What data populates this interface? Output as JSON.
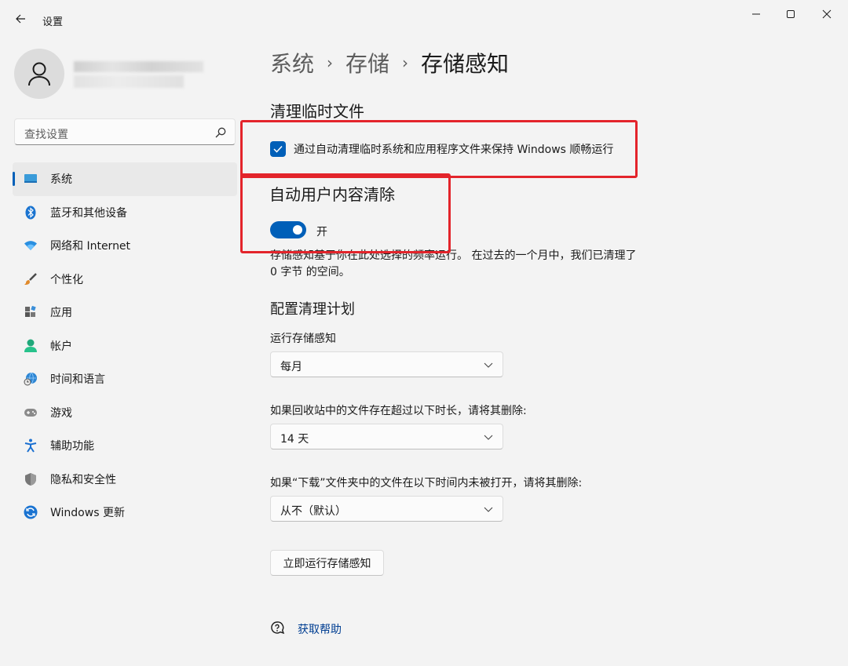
{
  "window": {
    "title": "设置"
  },
  "search": {
    "placeholder": "查找设置"
  },
  "nav": {
    "items": [
      {
        "label": "系统",
        "icon": "monitor-icon",
        "active": true
      },
      {
        "label": "蓝牙和其他设备",
        "icon": "bluetooth-icon"
      },
      {
        "label": "网络和 Internet",
        "icon": "wifi-icon"
      },
      {
        "label": "个性化",
        "icon": "brush-icon"
      },
      {
        "label": "应用",
        "icon": "apps-icon"
      },
      {
        "label": "帐户",
        "icon": "person-icon"
      },
      {
        "label": "时间和语言",
        "icon": "globe-clock-icon"
      },
      {
        "label": "游戏",
        "icon": "gamepad-icon"
      },
      {
        "label": "辅助功能",
        "icon": "accessibility-icon"
      },
      {
        "label": "隐私和安全性",
        "icon": "shield-icon"
      },
      {
        "label": "Windows 更新",
        "icon": "update-icon"
      }
    ]
  },
  "breadcrumb": {
    "part1": "系统",
    "part2": "存储",
    "current": "存储感知",
    "separator": "›"
  },
  "temp_files": {
    "heading": "清理临时文件",
    "checkbox_label": "通过自动清理临时系统和应用程序文件来保持 Windows 顺畅运行",
    "checked": true
  },
  "auto_cleanup": {
    "heading": "自动用户内容清除",
    "toggle_label": "开",
    "toggle_on": true,
    "description": "存储感知基于你在此处选择的频率运行。 在过去的一个月中，我们已清理了 0 字节 的空间。"
  },
  "schedule": {
    "heading": "配置清理计划",
    "run_label": "运行存储感知",
    "run_value": "每月",
    "recycle_label": "如果回收站中的文件存在超过以下时长，请将其删除:",
    "recycle_value": "14 天",
    "downloads_label": "如果“下载”文件夹中的文件在以下时间内未被打开，请将其删除:",
    "downloads_value": "从不（默认）"
  },
  "actions": {
    "run_now": "立即运行存储感知",
    "help": "获取帮助"
  },
  "colors": {
    "accent": "#005fb8",
    "highlight_box": "#e3242b",
    "background": "#f3f3f3",
    "link": "#003e92"
  }
}
